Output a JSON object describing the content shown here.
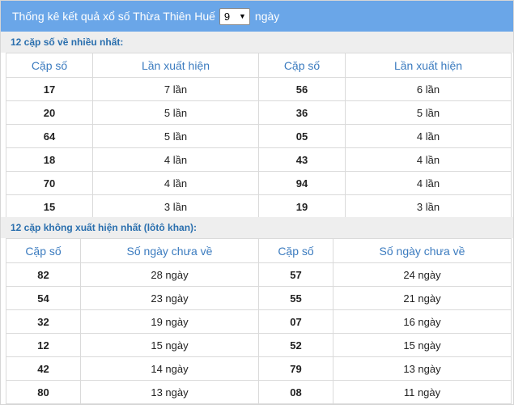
{
  "header": {
    "prefix": "Thống kê kết quả xổ số Thừa Thiên Huế",
    "select_value": "9",
    "suffix": "ngày"
  },
  "section1": {
    "title": "12 cặp số về nhiều nhất:",
    "columns": [
      "Cặp số",
      "Lần xuất hiện",
      "Cặp số",
      "Lần xuất hiện"
    ],
    "rows": [
      [
        "17",
        "7 lần",
        "56",
        "6 lần"
      ],
      [
        "20",
        "5 lần",
        "36",
        "5 lần"
      ],
      [
        "64",
        "5 lần",
        "05",
        "4 lần"
      ],
      [
        "18",
        "4 lần",
        "43",
        "4 lần"
      ],
      [
        "70",
        "4 lần",
        "94",
        "4 lần"
      ],
      [
        "15",
        "3 lần",
        "19",
        "3 lần"
      ]
    ]
  },
  "section2": {
    "title": "12 cặp không xuất hiện nhất (lôtô khan):",
    "columns": [
      "Cặp số",
      "Số ngày chưa về",
      "Cặp số",
      "Số ngày chưa về"
    ],
    "rows": [
      [
        "82",
        "28 ngày",
        "57",
        "24 ngày"
      ],
      [
        "54",
        "23 ngày",
        "55",
        "21 ngày"
      ],
      [
        "32",
        "19 ngày",
        "07",
        "16 ngày"
      ],
      [
        "12",
        "15 ngày",
        "52",
        "15 ngày"
      ],
      [
        "42",
        "14 ngày",
        "79",
        "13 ngày"
      ],
      [
        "80",
        "13 ngày",
        "08",
        "11 ngày"
      ]
    ]
  }
}
